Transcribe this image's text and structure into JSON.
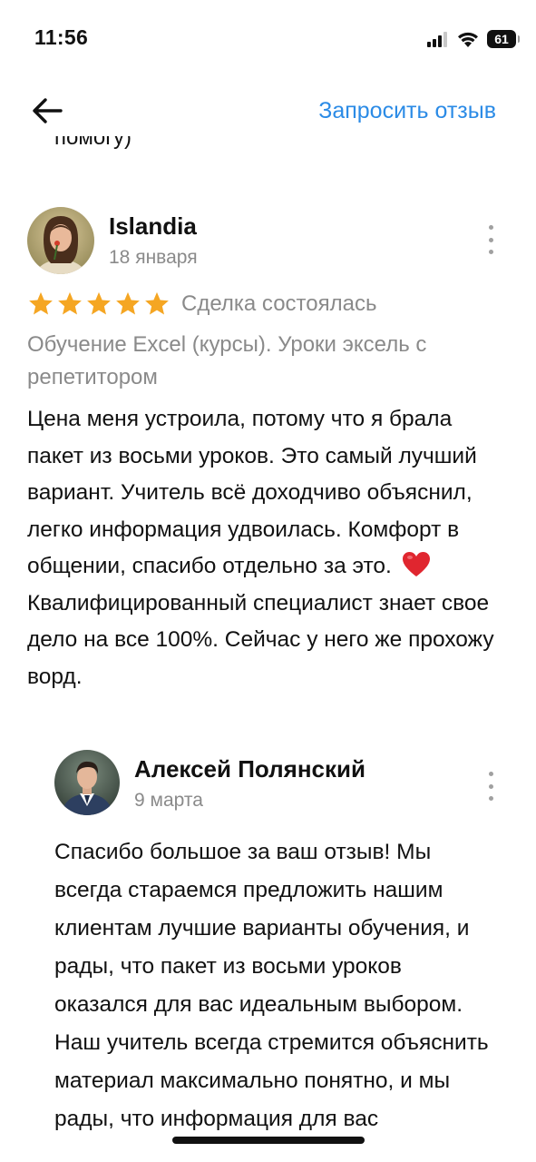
{
  "status_bar": {
    "time": "11:56",
    "battery": "61",
    "icons": [
      "signal-icon",
      "wifi-icon",
      "battery-icon"
    ]
  },
  "nav": {
    "back_icon": "back-arrow-icon",
    "request_review": "Запросить отзыв"
  },
  "previous_text_fragment": "помогу)",
  "review": {
    "author": "Islandia",
    "date": "18 января",
    "rating": 5,
    "deal_status": "Сделка состоялась",
    "service": "Обучение Excel (курсы). Уроки эксель с репетитором",
    "text": "Цена меня устроила, потому что я брала пакет из восьми уроков.  Это самый лучший вариант. Учитель всё доходчиво объяснил, легко информация удвоилась. Комфорт в общении, спасибо отдельно за это.",
    "text_after_heart": "Квалифицированный специалист знает свое дело на все 100%. Сейчас у него же прохожу ворд."
  },
  "reply": {
    "author": "Алексей Полянский",
    "date": "9 марта",
    "text": "Спасибо большое за ваш отзыв! Мы всегда стараемся предложить нашим клиентам лучшие варианты обучения, и рады, что пакет из восьми уроков оказался для вас идеальным выбором. Наш учитель всегда стремится объяснить материал максимально понятно, и мы рады, что информация для вас"
  },
  "colors": {
    "accent": "#2b8be6",
    "star": "#f5a623",
    "muted": "#8a8a8a",
    "heart": "#e0262f"
  }
}
